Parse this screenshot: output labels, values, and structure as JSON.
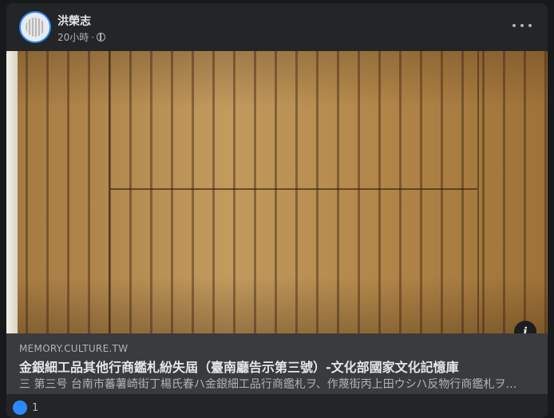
{
  "post": {
    "author": "洪榮志",
    "time": "20小時",
    "separator": "·",
    "privacy_icon": "globe-icon",
    "more_icon": "more-horizontal-icon"
  },
  "link_preview": {
    "domain": "MEMORY.CULTURE.TW",
    "title": "金銀細工品其他行商鑑札紛失屆（臺南廳告示第三號）-文化部國家文化記憶庫",
    "description": "三 第三号 台南市蕃薯崎街丁楊氏春ハ金銀細工品行商鑑札ヲ、作蔑街丙上田ウシハ反物行商鑑札ヲ紛失セリ",
    "info_icon": "info-icon"
  },
  "reactions": {
    "icon": "like-icon",
    "count": "1"
  },
  "colors": {
    "card_bg": "#242526",
    "link_bg": "#3a3b3c",
    "accent": "#2d88ff"
  }
}
